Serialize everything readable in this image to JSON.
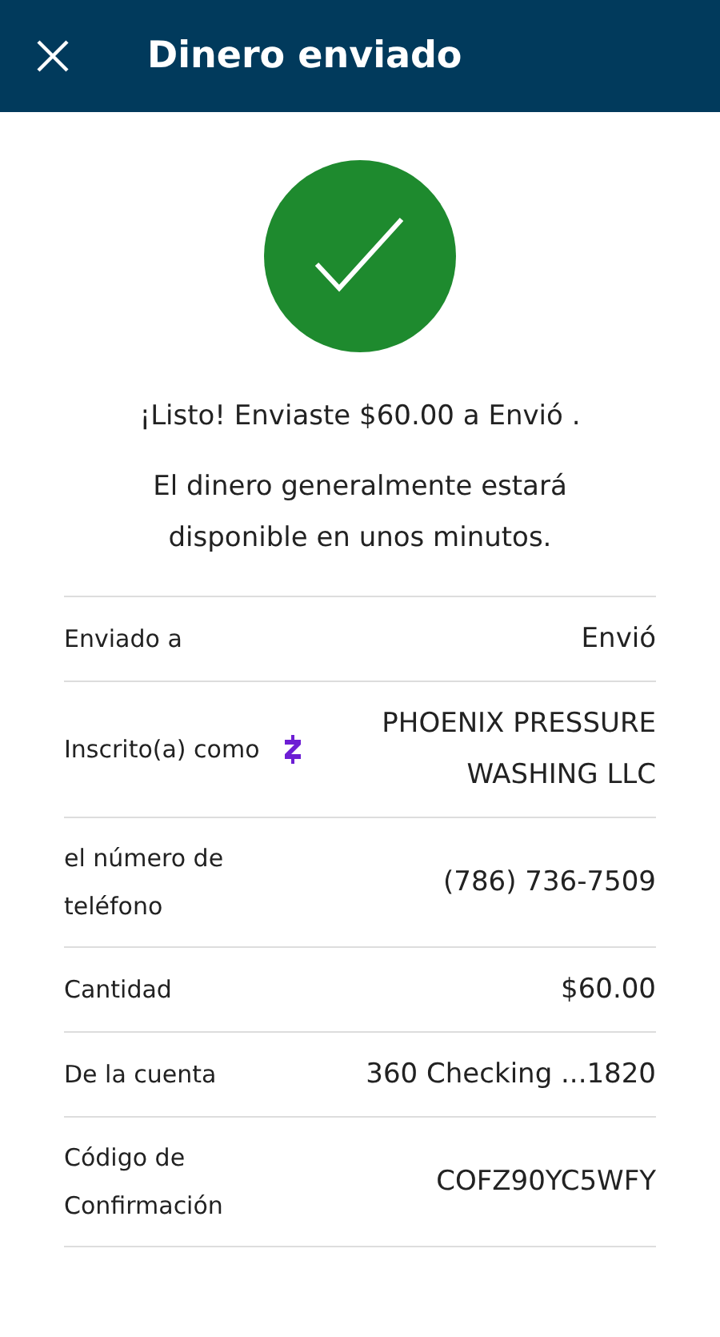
{
  "header": {
    "title": "Dinero enviado"
  },
  "status": {
    "success": true
  },
  "message": "¡Listo! Enviaste $60.00 a Envió .",
  "note": "El dinero generalmente estará disponible en unos minutos.",
  "details": [
    {
      "label": "Enviado a",
      "value": "Envió"
    },
    {
      "label": "Inscrito(a) como",
      "value": "PHOENIX PRESSURE WASHING LLC",
      "kind": "zelle"
    },
    {
      "label": "el número de teléfono",
      "value": "(786) 736-7509"
    },
    {
      "label": "Cantidad",
      "value": "$60.00"
    },
    {
      "label": "De la cuenta",
      "value": "360 Checking ...1820"
    },
    {
      "label": "Código de Confirmación",
      "value": "COFZ90YC5WFY"
    }
  ]
}
